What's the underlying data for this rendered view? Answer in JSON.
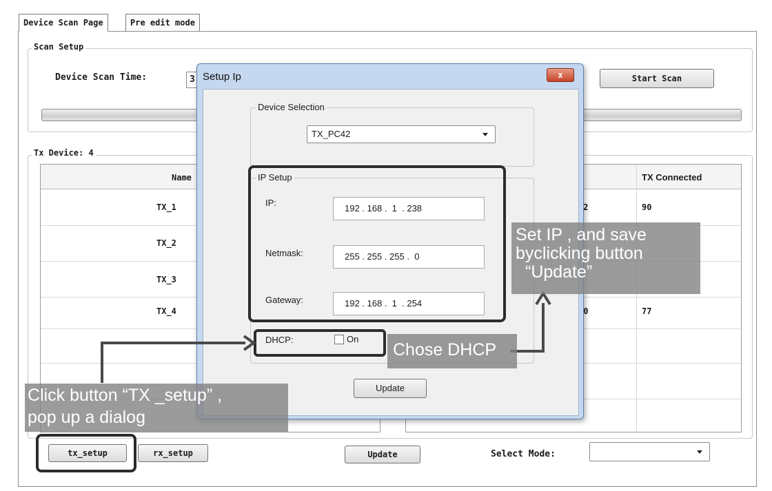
{
  "tabs": [
    "Device Scan Page",
    "Pre edit mode"
  ],
  "scan_setup": {
    "legend": "Scan Setup",
    "time_label": "Device Scan Time:",
    "time_value": "3",
    "start_button": "Start Scan"
  },
  "tx_device": {
    "legend": "Tx Device: 4",
    "header_name": "Name",
    "header_right1": "",
    "header_tx_connected": "TX Connected",
    "rows": [
      {
        "name": "TX_1",
        "mid": "32",
        "connected": "90"
      },
      {
        "name": "TX_2",
        "mid": "",
        "connected": ""
      },
      {
        "name": "TX_3",
        "mid": "",
        "connected": ""
      },
      {
        "name": "TX_4",
        "mid": "30",
        "connected": "77"
      }
    ]
  },
  "bottom": {
    "tx_setup": "tx_setup",
    "rx_setup": "rx_setup",
    "update": "Update",
    "select_mode_label": "Select Mode:",
    "select_mode_value": ""
  },
  "dialog": {
    "title": "Setup Ip",
    "close": "x",
    "device_selection_legend": "Device Selection",
    "device_selected": "TX_PC42",
    "ip_setup_legend": "IP Setup",
    "ip_label": "IP:",
    "ip_value": "192 . 168 .  1  . 238",
    "netmask_label": "Netmask:",
    "netmask_value": "255 . 255 . 255 .  0",
    "gateway_label": "Gateway:",
    "gateway_value": "192 . 168 .  1  . 254",
    "dhcp_label": "DHCP:",
    "dhcp_on_label": "On",
    "dhcp_checked": false,
    "update_button": "Update"
  },
  "annotations": {
    "set_ip_line1": "Set IP , and save",
    "set_ip_line2": "byclicking button",
    "set_ip_line3": "“Update”",
    "chose_dhcp": "Chose DHCP",
    "click_line1": "Click button  “TX _setup” ,",
    "click_line2": "pop up a dialog"
  }
}
